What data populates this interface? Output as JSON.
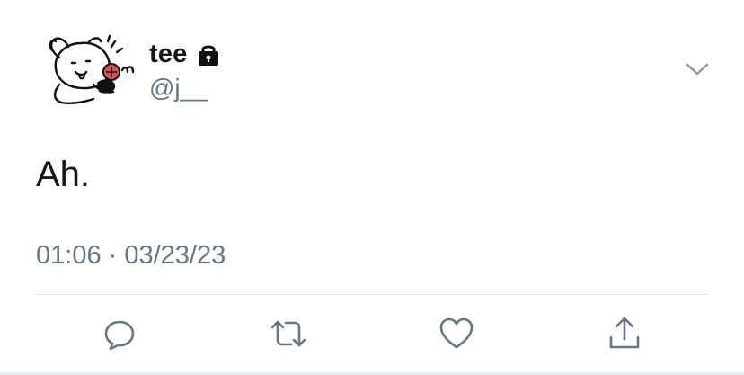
{
  "user": {
    "display_name": "tee",
    "handle": "@j__",
    "avatar_icon": "cartoon-dog-avatar",
    "protected_icon": "lock-icon"
  },
  "tweet": {
    "text": "Ah.",
    "timestamp": "01:06 · 03/23/23"
  },
  "actions": [
    {
      "name": "reply",
      "icon": "speech-bubble-icon"
    },
    {
      "name": "retweet",
      "icon": "retweet-arrows-icon"
    },
    {
      "name": "like",
      "icon": "heart-icon"
    },
    {
      "name": "share",
      "icon": "share-upload-icon"
    }
  ],
  "menu_icon": "chevron-down-icon",
  "colors": {
    "text_primary": "#14171a",
    "text_secondary": "#657786",
    "icon_gray": "#657786",
    "divider": "#e1e8ed"
  }
}
